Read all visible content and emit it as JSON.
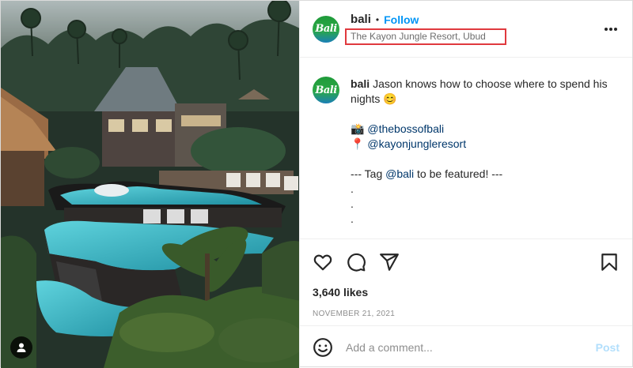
{
  "account": {
    "username": "bali",
    "separator": "•",
    "follow_label": "Follow",
    "location": "The Kayon Jungle Resort, Ubud",
    "avatar_text": "Bali"
  },
  "caption": {
    "username": "bali",
    "text_line1": "Jason knows how to choose where to spend his nights",
    "emoji": "😊",
    "camera_emoji": "📸",
    "mention1": "@thebossofbali",
    "pin_emoji": "📍",
    "mention2": "@kayonjungleresort",
    "tag_prefix": "--- Tag ",
    "tag_mention": "@bali",
    "tag_suffix": " to be featured! ---",
    "dots": [
      ".",
      ".",
      "."
    ]
  },
  "actions": {
    "like_icon": "heart-icon",
    "comment_icon": "comment-icon",
    "share_icon": "paper-plane-icon",
    "save_icon": "bookmark-icon"
  },
  "stats": {
    "likes": "3,640 likes",
    "date": "NOVEMBER 21, 2021"
  },
  "comment": {
    "placeholder": "Add a comment...",
    "post_label": "Post"
  },
  "colors": {
    "accent": "#0095f6",
    "mention": "#00376b",
    "highlight_border": "#e0393e",
    "post_disabled": "#b2dffc"
  }
}
